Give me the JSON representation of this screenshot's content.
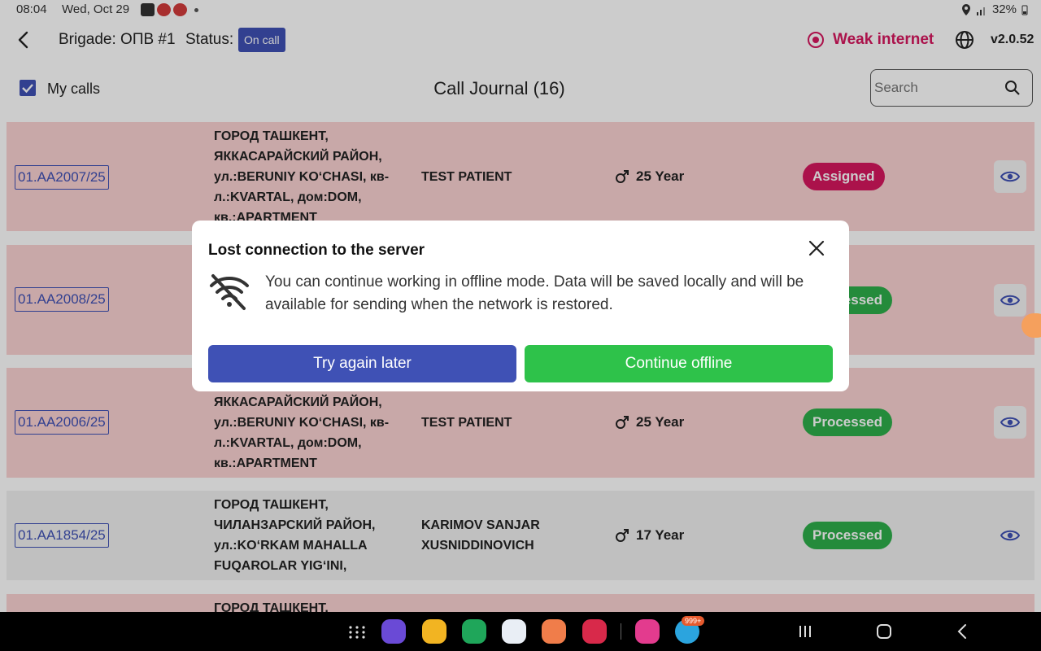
{
  "statusbar": {
    "time": "08:04",
    "date": "Wed, Oct 29",
    "battery": "32%"
  },
  "appbar": {
    "brigade": "Brigade: ОПВ #1",
    "status_label": "Status:",
    "status_value": "On call",
    "network": "Weak internet",
    "version": "v2.0.52"
  },
  "toolbar": {
    "my_calls_label": "My calls",
    "title": "Call Journal (16)",
    "search_placeholder": "Search"
  },
  "calls": [
    {
      "id": "01.AA2007/25",
      "address": "ГОРОД  ТАШКЕНТ, ЯККАСАРАЙСКИЙ РАЙОН, ул.:BERUNIY KOʻCHASI, кв-л.:KVARTAL, дом:DOM, кв.:APARTMENT",
      "patient": "TEST PATIENT",
      "age": "25 Year",
      "status": "Assigned"
    },
    {
      "id": "01.AA2008/25",
      "address": "",
      "patient": "",
      "age": "",
      "status": "Processed"
    },
    {
      "id": "01.AA2006/25",
      "address": "ЯККАСАРАЙСКИЙ РАЙОН, ул.:BERUNIY KOʻCHASI, кв-л.:KVARTAL, дом:DOM, кв.:APARTMENT",
      "patient": "TEST PATIENT",
      "age": "25 Year",
      "status": "Processed"
    },
    {
      "id": "01.AA1854/25",
      "address": "ГОРОД  ТАШКЕНТ, ЧИЛАНЗАРСКИЙ РАЙОН, ул.:KOʻRKAM MAHALLA FUQAROLAR YIGʻINI,",
      "patient": "KARIMOV SANJAR XUSNIDDINOVICH",
      "age": "17 Year",
      "status": "Processed"
    },
    {
      "id": "",
      "address": "ГОРОД  ТАШКЕНТ,",
      "patient": "",
      "age": "",
      "status": ""
    }
  ],
  "dialog": {
    "title": "Lost connection to the server",
    "message": "You can continue working in offline mode. Data will be saved locally and will be available for sending when the network is restored.",
    "try_later": "Try again later",
    "continue_offline": "Continue offline"
  },
  "navbar": {
    "notification_count": "999+"
  },
  "colors": {
    "primary": "#3f51b5",
    "assigned": "#d6175e",
    "processed": "#2eae4a",
    "row_pink": "#fbd2d2",
    "row_grey": "#f1f1f1"
  }
}
